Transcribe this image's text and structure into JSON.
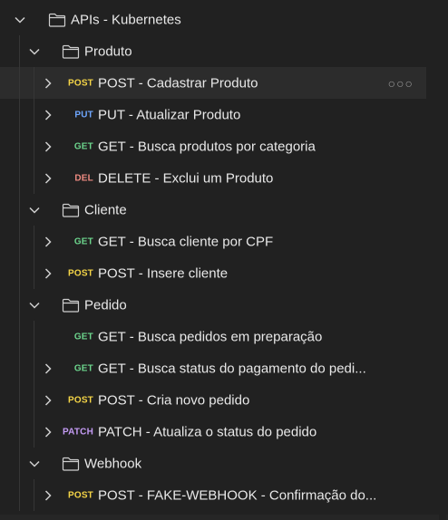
{
  "collection": {
    "name": "APIs - Kubernetes",
    "folders": [
      {
        "name": "Produto",
        "requests": [
          {
            "method": "POST",
            "name": "POST - Cadastrar Produto",
            "selected": true,
            "more": "○○○"
          },
          {
            "method": "PUT",
            "name": "PUT - Atualizar Produto"
          },
          {
            "method": "GET",
            "name": "GET - Busca produtos por categoria"
          },
          {
            "method": "DEL",
            "name": "DELETE - Exclui um Produto"
          }
        ]
      },
      {
        "name": "Cliente",
        "requests": [
          {
            "method": "GET",
            "name": "GET - Busca cliente por CPF"
          },
          {
            "method": "POST",
            "name": "POST - Insere cliente"
          }
        ]
      },
      {
        "name": "Pedido",
        "requests": [
          {
            "method": "GET",
            "name": "GET - Busca pedidos em preparação",
            "no_chevron": true
          },
          {
            "method": "GET",
            "name": "GET - Busca status do pagamento do pedi..."
          },
          {
            "method": "POST",
            "name": "POST - Cria novo pedido"
          },
          {
            "method": "PATCH",
            "name": "PATCH - Atualiza o status do pedido"
          }
        ]
      },
      {
        "name": "Webhook",
        "requests": [
          {
            "method": "POST",
            "name": "POST - FAKE-WEBHOOK - Confirmação do..."
          }
        ]
      }
    ]
  },
  "colors": {
    "POST": "#f5d547",
    "PUT": "#6fa7ff",
    "GET": "#6cd48c",
    "DEL": "#f08c82",
    "PATCH": "#c59cf5"
  },
  "icons": {
    "expanded": "chevron-down-icon",
    "collapsed": "chevron-right-icon",
    "folder": "folder-icon",
    "more": "more-options-icon"
  }
}
